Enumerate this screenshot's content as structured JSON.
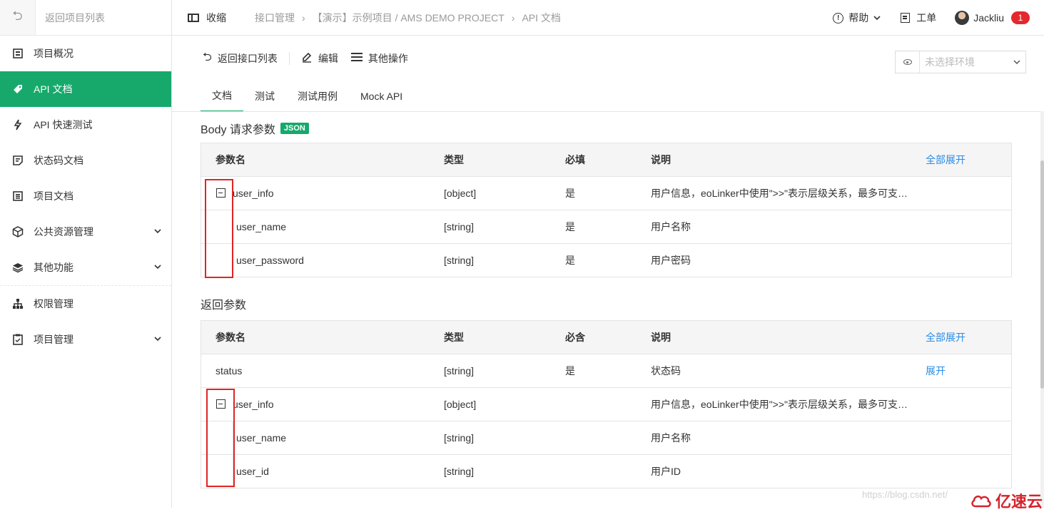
{
  "sidebar": {
    "back_label": "返回项目列表",
    "items": [
      {
        "label": "项目概况",
        "icon": "overview-icon"
      },
      {
        "label": "API 文档",
        "icon": "tag-icon",
        "active": true
      },
      {
        "label": "API 快速测试",
        "icon": "lightning-icon"
      },
      {
        "label": "状态码文档",
        "icon": "status-doc-icon"
      },
      {
        "label": "项目文档",
        "icon": "doc-icon"
      },
      {
        "label": "公共资源管理",
        "icon": "cube-icon",
        "expandable": true
      },
      {
        "label": "其他功能",
        "icon": "layers-icon",
        "expandable": true
      },
      {
        "label": "权限管理",
        "icon": "hierarchy-icon"
      },
      {
        "label": "项目管理",
        "icon": "clipboard-icon",
        "expandable": true
      }
    ]
  },
  "topbar": {
    "collapse_label": "收缩",
    "breadcrumbs": [
      "接口管理",
      "【演示】示例项目 / AMS DEMO PROJECT",
      "API 文档"
    ],
    "help_label": "帮助",
    "workorder_label": "工单",
    "user_name": "Jackliu",
    "notification_count": "1"
  },
  "toolbar": {
    "back_label": "返回接口列表",
    "edit_label": "编辑",
    "more_label": "其他操作",
    "env_placeholder": "未选择环境"
  },
  "tabs": [
    "文档",
    "测试",
    "测试用例",
    "Mock API"
  ],
  "body_params": {
    "title": "Body 请求参数",
    "tag": "JSON",
    "headers": {
      "name": "参数名",
      "type": "类型",
      "required": "必填",
      "desc": "说明",
      "action": "全部展开"
    },
    "rows": [
      {
        "name": "user_info",
        "type": "[object]",
        "required": "是",
        "desc": "用户信息，eoLinker中使用\">>\"表示层级关系，最多可支…"
      },
      {
        "name": "user_name",
        "type": "[string]",
        "required": "是",
        "desc": "用户名称"
      },
      {
        "name": "user_password",
        "type": "[string]",
        "required": "是",
        "desc": "用户密码"
      }
    ]
  },
  "return_params": {
    "title": "返回参数",
    "headers": {
      "name": "参数名",
      "type": "类型",
      "required": "必含",
      "desc": "说明",
      "action": "全部展开"
    },
    "rows": [
      {
        "name": "status",
        "type": "[string]",
        "required": "是",
        "desc": "状态码",
        "action": "展开"
      },
      {
        "name": "user_info",
        "type": "[object]",
        "required": "",
        "desc": "用户信息，eoLinker中使用\">>\"表示层级关系，最多可支…"
      },
      {
        "name": "user_name",
        "type": "[string]",
        "required": "",
        "desc": "用户名称"
      },
      {
        "name": "user_id",
        "type": "[string]",
        "required": "",
        "desc": "用户ID"
      }
    ]
  },
  "watermark": "https://blog.csdn.net/",
  "brand": "亿速云",
  "colors": {
    "accent": "#16a96b",
    "link": "#2a8ce8",
    "badge": "#e5272e",
    "annotation": "#e02424"
  }
}
